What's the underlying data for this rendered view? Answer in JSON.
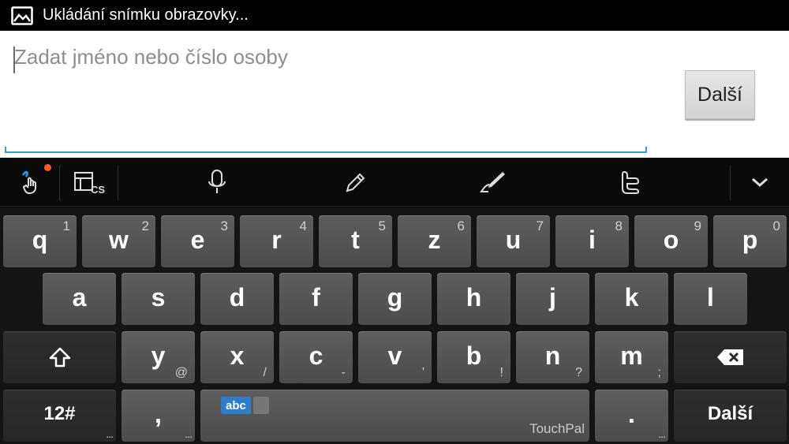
{
  "status_bar": {
    "icon": "image-icon",
    "text": "Ukládání snímku obrazovky..."
  },
  "input": {
    "placeholder": "Zadat jméno nebo číslo osoby",
    "value": ""
  },
  "next_button": {
    "label": "Další"
  },
  "toolbar": {
    "items": [
      "touchpal-gesture-icon",
      "layout-cs-icon",
      "microphone-icon",
      "pencil-icon",
      "handwriting-icon",
      "twitter-icon",
      "chevron-down-icon"
    ],
    "language_code": "CS",
    "accent": "#ff5a2a"
  },
  "keyboard": {
    "row1": [
      {
        "key": "q",
        "sub": "1"
      },
      {
        "key": "w",
        "sub": "2"
      },
      {
        "key": "e",
        "sub": "3"
      },
      {
        "key": "r",
        "sub": "4"
      },
      {
        "key": "t",
        "sub": "5"
      },
      {
        "key": "z",
        "sub": "6"
      },
      {
        "key": "u",
        "sub": "7"
      },
      {
        "key": "i",
        "sub": "8"
      },
      {
        "key": "o",
        "sub": "9"
      },
      {
        "key": "p",
        "sub": "0"
      }
    ],
    "row2": [
      {
        "key": "a"
      },
      {
        "key": "s"
      },
      {
        "key": "d"
      },
      {
        "key": "f"
      },
      {
        "key": "g"
      },
      {
        "key": "h"
      },
      {
        "key": "j"
      },
      {
        "key": "k"
      },
      {
        "key": "l"
      }
    ],
    "row3": [
      {
        "key": "y",
        "sub": "@"
      },
      {
        "key": "x",
        "sub": "/"
      },
      {
        "key": "c",
        "sub": "-"
      },
      {
        "key": "v",
        "sub": "'"
      },
      {
        "key": "b",
        "sub": "!"
      },
      {
        "key": "n",
        "sub": "?"
      },
      {
        "key": "m",
        "sub": ";"
      }
    ],
    "numbers_label": "12#",
    "comma_label": ",",
    "space_lang_label": "abc",
    "space_brand": "TouchPal",
    "period_label": ".",
    "enter_label": "Další",
    "ellipsis": "..."
  }
}
